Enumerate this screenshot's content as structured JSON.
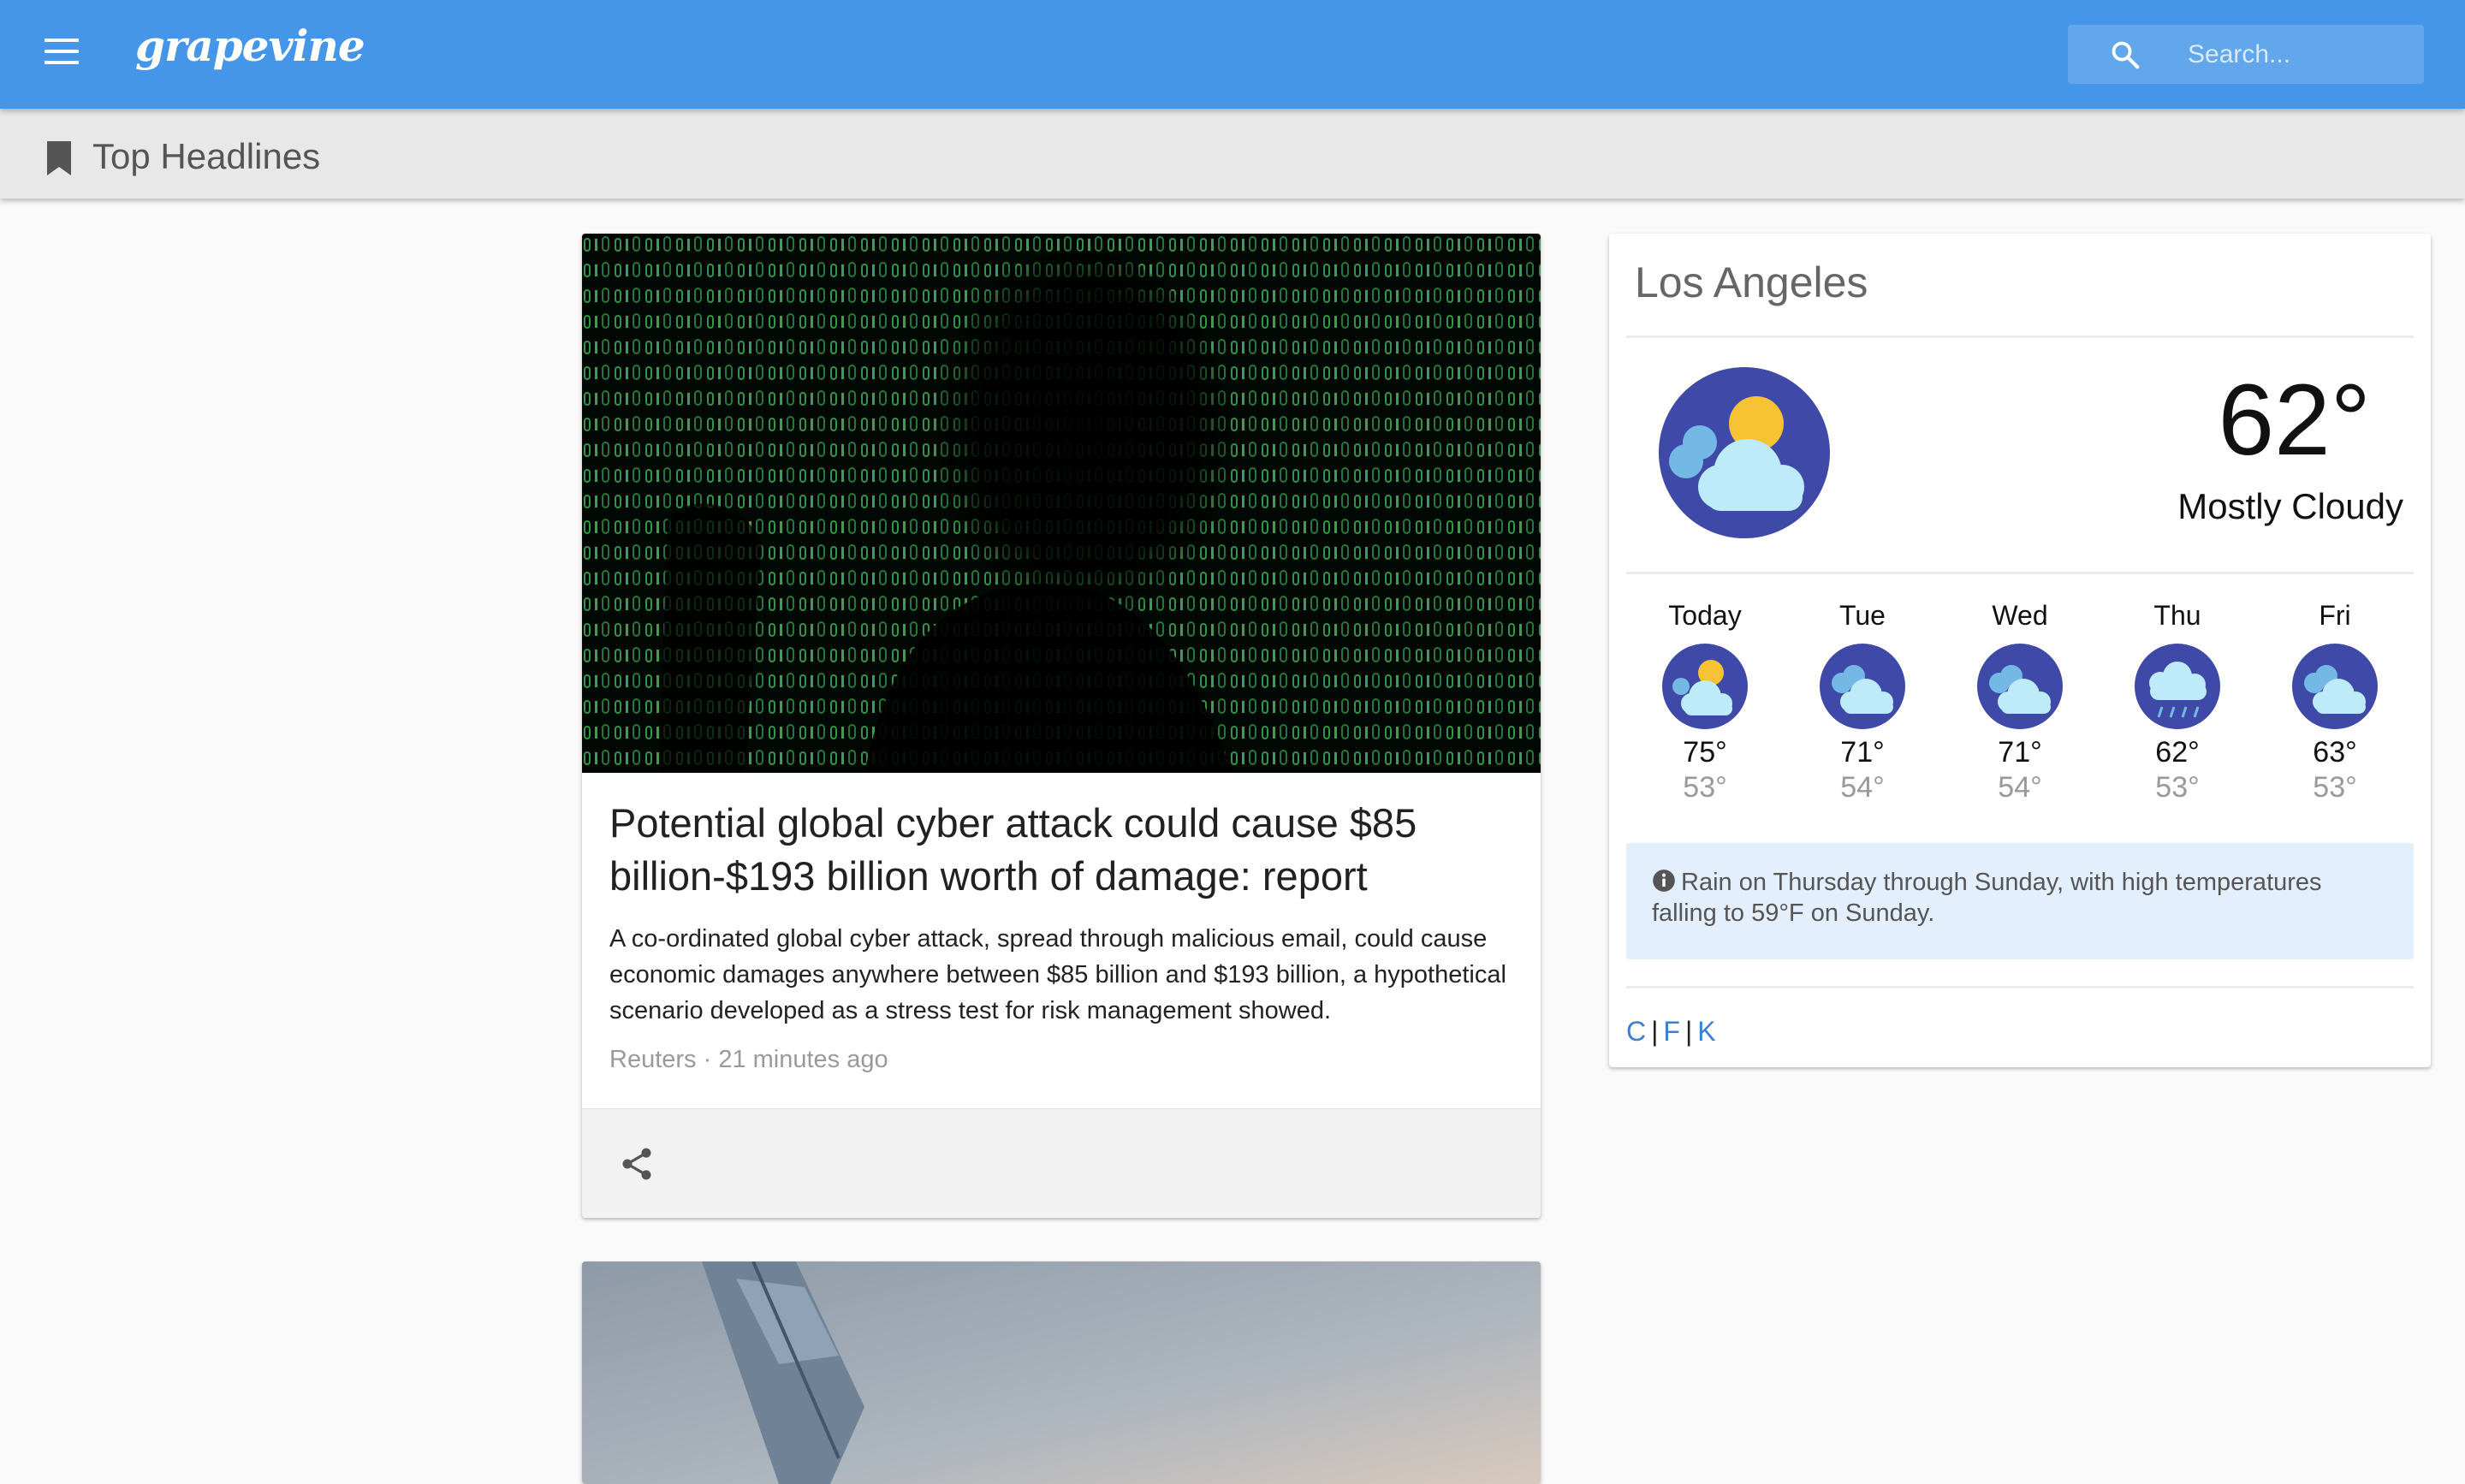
{
  "app": {
    "logo": "grapevine"
  },
  "search": {
    "placeholder": "Search..."
  },
  "section": {
    "title": "Top Headlines"
  },
  "articles": [
    {
      "headline": "Potential global cyber attack could cause $85 billion-$193 billion worth of damage: report",
      "summary": "A co-ordinated global cyber attack, spread through malicious email, could cause economic damages anywhere between $85 billion and $193 billion, a hypothetical scenario developed as a stress test for risk management showed.",
      "source": "Reuters · 21 minutes ago",
      "image_icon": "hacker-binary-code-image"
    },
    {
      "image_icon": "airplane-wing-image"
    }
  ],
  "weather": {
    "city": "Los Angeles",
    "current_temp": "62°",
    "condition": "Mostly Cloudy",
    "current_icon": "partly-cloudy-icon",
    "forecast": [
      {
        "day": "Today",
        "high": "75°",
        "low": "53°",
        "icon": "partly-cloudy-icon"
      },
      {
        "day": "Tue",
        "high": "71°",
        "low": "54°",
        "icon": "cloudy-icon"
      },
      {
        "day": "Wed",
        "high": "71°",
        "low": "54°",
        "icon": "cloudy-icon"
      },
      {
        "day": "Thu",
        "high": "62°",
        "low": "53°",
        "icon": "rain-icon"
      },
      {
        "day": "Fri",
        "high": "63°",
        "low": "53°",
        "icon": "cloudy-icon"
      }
    ],
    "alert": "Rain on Thursday through Sunday, with high temperatures falling to 59°F on Sunday.",
    "units": [
      "C",
      "F",
      "K"
    ]
  },
  "colors": {
    "appbar": "#4596e8",
    "subbar": "#e8e8e8",
    "alert_bg": "#e3effc",
    "link": "#3f7fd0",
    "icon_circle": "#3f4aa8"
  }
}
